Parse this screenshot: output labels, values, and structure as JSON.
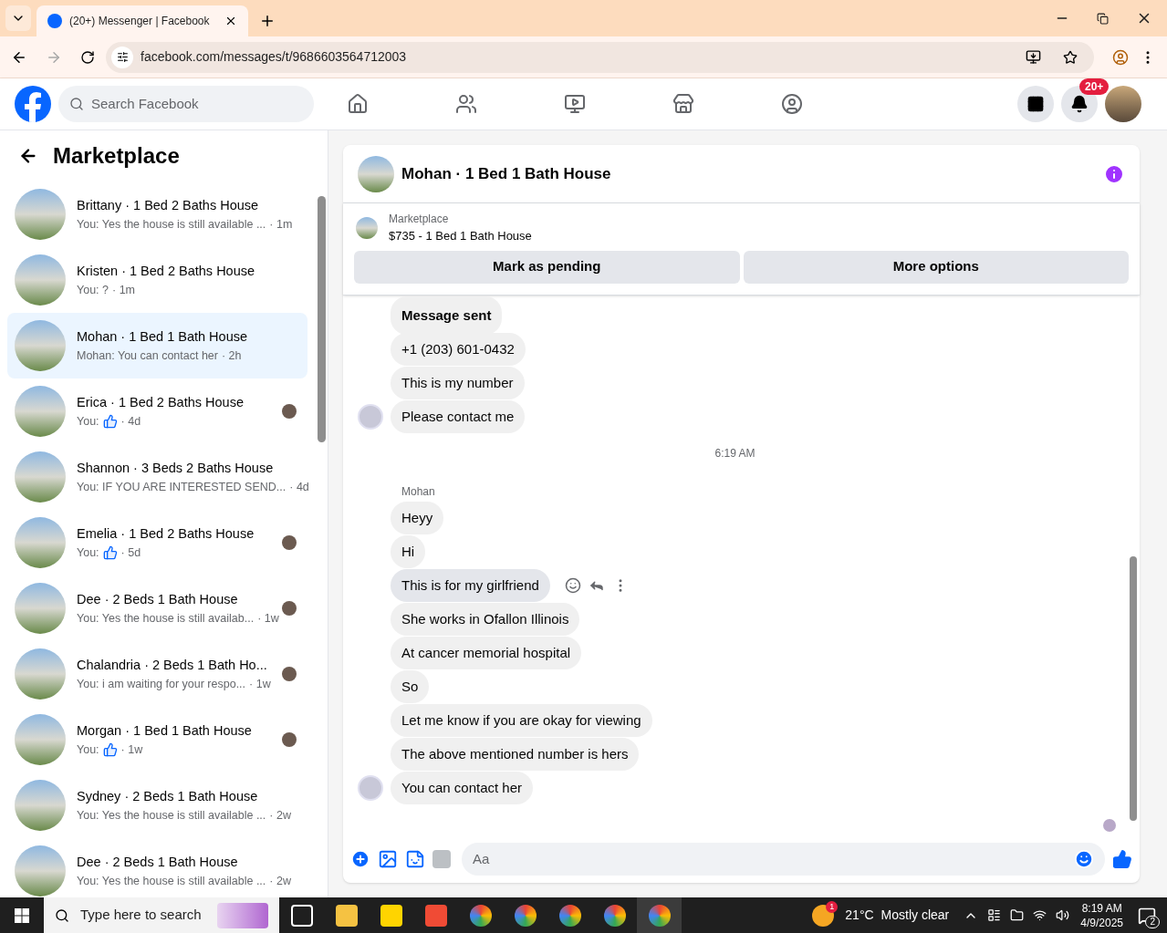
{
  "browser": {
    "tab_title": "(20+) Messenger | Facebook",
    "url": "facebook.com/messages/t/9686603564712003"
  },
  "header": {
    "search": {
      "placeholder": "Search Facebook"
    },
    "notification_badge": "20+"
  },
  "sidebar": {
    "title": "Marketplace",
    "conversations": [
      {
        "title": "Brittany · 1 Bed 2 Baths House",
        "preview": "You: Yes the house is still available ...",
        "like": false,
        "time": "· 1m",
        "seen": false,
        "selected": false
      },
      {
        "title": "Kristen · 1 Bed 2 Baths House",
        "preview": "You: ?",
        "like": false,
        "time": "· 1m",
        "seen": false,
        "selected": false
      },
      {
        "title": "Mohan · 1 Bed 1 Bath House",
        "preview": "Mohan: You can contact her",
        "like": false,
        "time": "· 2h",
        "seen": false,
        "selected": true
      },
      {
        "title": "Erica · 1 Bed 2 Baths House",
        "preview": "You:",
        "like": true,
        "time": "· 4d",
        "seen": true,
        "selected": false
      },
      {
        "title": "Shannon · 3 Beds 2 Baths House",
        "preview": "You: IF YOU ARE INTERESTED SEND...",
        "like": false,
        "time": "· 4d",
        "seen": false,
        "selected": false
      },
      {
        "title": "Emelia · 1 Bed 2 Baths House",
        "preview": "You:",
        "like": true,
        "time": "· 5d",
        "seen": true,
        "selected": false
      },
      {
        "title": "Dee · 2 Beds 1 Bath House",
        "preview": "You: Yes the house is still availab...",
        "like": false,
        "time": "· 1w",
        "seen": true,
        "selected": false
      },
      {
        "title": "Chalandria · 2 Beds 1 Bath Ho...",
        "preview": "You: i am waiting for your respo...",
        "like": false,
        "time": "· 1w",
        "seen": true,
        "selected": false
      },
      {
        "title": "Morgan · 1 Bed 1 Bath House",
        "preview": "You:",
        "like": true,
        "time": "· 1w",
        "seen": true,
        "selected": false
      },
      {
        "title": "Sydney · 2 Beds 1 Bath House",
        "preview": "You: Yes the house is still available ...",
        "like": false,
        "time": "· 2w",
        "seen": false,
        "selected": false
      },
      {
        "title": "Dee · 2 Beds 1 Bath House",
        "preview": "You: Yes the house is still available ...",
        "like": false,
        "time": "· 2w",
        "seen": false,
        "selected": false
      }
    ]
  },
  "chat": {
    "title": "Mohan · 1 Bed 1 Bath House",
    "listing_label": "Marketplace",
    "listing": "$735 - 1 Bed 1 Bath House",
    "buttons": [
      "Mark as pending",
      "More options"
    ],
    "messages": [
      {
        "kind": "bold_text",
        "text": "Message sent",
        "avatar": false,
        "hovered": false
      },
      {
        "kind": "text",
        "text": "+1 (203) 601-0432",
        "avatar": false,
        "hovered": false
      },
      {
        "kind": "text",
        "text": "This is my number",
        "avatar": false,
        "hovered": false
      },
      {
        "kind": "text",
        "text": "Please contact me",
        "avatar": true,
        "hovered": false
      },
      {
        "kind": "time",
        "text": "6:19 AM"
      },
      {
        "kind": "sender",
        "text": "Mohan"
      },
      {
        "kind": "text",
        "text": "Heyy",
        "avatar": false,
        "hovered": false
      },
      {
        "kind": "text",
        "text": "Hi",
        "avatar": false,
        "hovered": false
      },
      {
        "kind": "text",
        "text": "This is for my girlfriend",
        "avatar": false,
        "hovered": true
      },
      {
        "kind": "text",
        "text": "She works in Ofallon Illinois",
        "avatar": false,
        "hovered": false
      },
      {
        "kind": "text",
        "text": "At cancer memorial hospital",
        "avatar": false,
        "hovered": false
      },
      {
        "kind": "text",
        "text": "So",
        "avatar": false,
        "hovered": false
      },
      {
        "kind": "text",
        "text": "Let me know if you are okay for viewing",
        "avatar": false,
        "hovered": false
      },
      {
        "kind": "text",
        "text": "The above mentioned number is hers",
        "avatar": false,
        "hovered": false
      },
      {
        "kind": "text",
        "text": "You can contact her",
        "avatar": true,
        "hovered": false
      }
    ],
    "composer": {
      "placeholder": "Aa"
    }
  },
  "taskbar": {
    "search": {
      "placeholder": "Type here to search"
    },
    "weather_badge": "1",
    "temperature": "21°C",
    "weather": "Mostly clear",
    "time": "8:19 AM",
    "date": "4/9/2025",
    "notifications": "2"
  }
}
